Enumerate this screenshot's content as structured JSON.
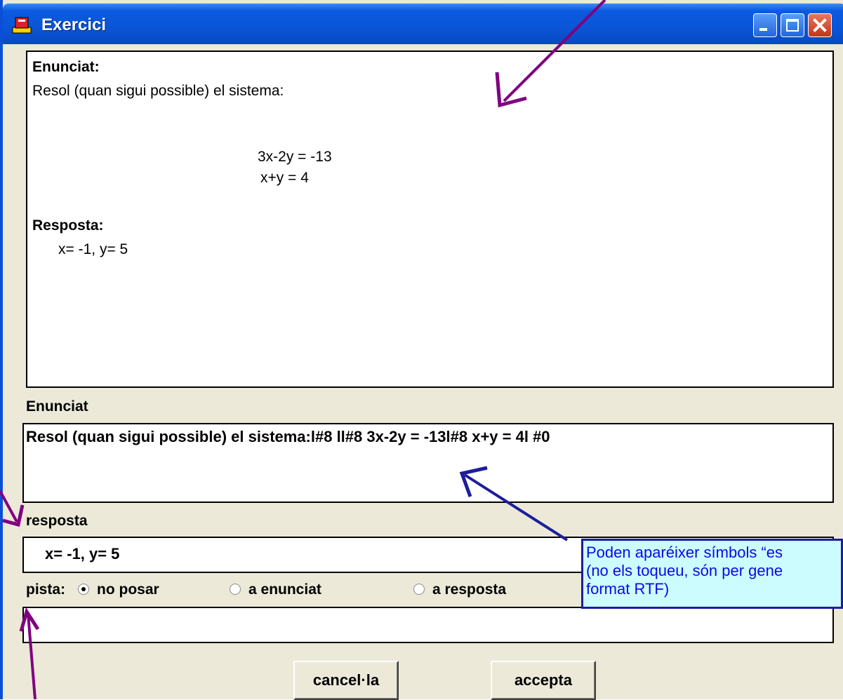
{
  "window": {
    "title": "Exercici",
    "icon": "app-exercise-icon"
  },
  "preview": {
    "enunciat_heading": "Enunciat:",
    "enunciat_text": "Resol (quan sigui possible) el sistema:",
    "equation_1": "3x-2y = -13",
    "equation_2": "x+y = 4",
    "resposta_heading": "Resposta:",
    "resposta_text": "x= -1, y= 5"
  },
  "form": {
    "enunciat_label": "Enunciat",
    "enunciat_value": "Resol (quan sigui possible) el sistema:l#8 ll#8 3x-2y = -13l#8 x+y = 4l #0",
    "resposta_label": "resposta",
    "resposta_value": "x= -1, y= 5",
    "pista_label": "pista:",
    "pista_options": [
      "no posar",
      "a enunciat",
      "a resposta"
    ],
    "pista_selected": "no posar",
    "pista_value": ""
  },
  "buttons": {
    "cancel": "cancel·la",
    "accept": "accepta"
  },
  "callout": {
    "line1": "Poden aparéixer símbols “es",
    "line2": "(no els toqueu, són per gene",
    "line3": "format  RTF)"
  },
  "colors": {
    "titlebar": "#0a55d6",
    "window_bg": "#ece9d8",
    "callout_bg": "#ccfcfd",
    "callout_text": "#0a0ae6",
    "arrow_purple": "#800080",
    "arrow_navy": "#1d1d9c"
  }
}
